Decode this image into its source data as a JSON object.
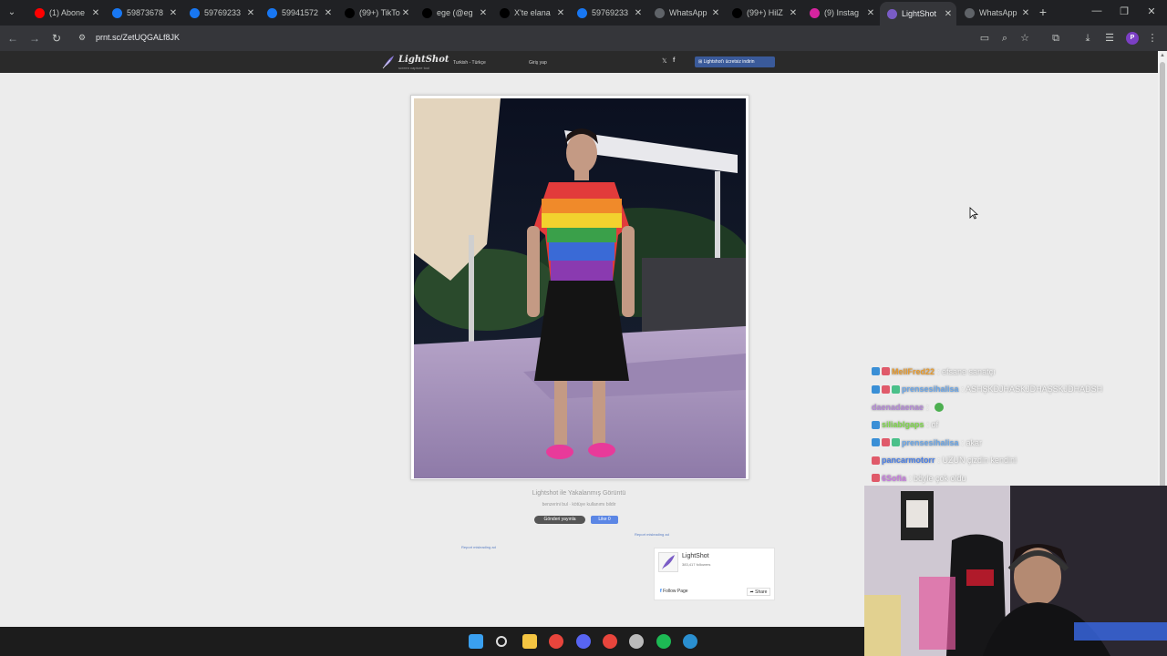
{
  "browser": {
    "tabs": [
      {
        "title": "(1) Abone",
        "favicon": "youtube-icon",
        "color": "#ff0000"
      },
      {
        "title": "59873678",
        "favicon": "facebook-icon",
        "color": "#1877f2"
      },
      {
        "title": "59769233",
        "favicon": "facebook-icon",
        "color": "#1877f2"
      },
      {
        "title": "59941572",
        "favicon": "facebook-icon",
        "color": "#1877f2"
      },
      {
        "title": "(99+) TikTo",
        "favicon": "tiktok-icon",
        "color": "#000000"
      },
      {
        "title": "ege (@eg",
        "favicon": "x-icon",
        "color": "#000000"
      },
      {
        "title": "X'te elana",
        "favicon": "x-icon",
        "color": "#000000"
      },
      {
        "title": "59769233",
        "favicon": "facebook-icon",
        "color": "#1877f2"
      },
      {
        "title": "WhatsApp",
        "favicon": "globe-icon",
        "color": "#5f6368"
      },
      {
        "title": "(99+) HilZ",
        "favicon": "tiktok-icon",
        "color": "#000000"
      },
      {
        "title": "(9) Instag",
        "favicon": "instagram-icon",
        "color": "#d6249f"
      },
      {
        "title": "LightShot",
        "favicon": "lightshot-icon",
        "color": "#7a5cc6",
        "active": true
      },
      {
        "title": "WhatsApp",
        "favicon": "globe-icon",
        "color": "#5f6368"
      }
    ],
    "url": "prnt.sc/ZetUQGALf8JK",
    "profile_initial": "P"
  },
  "lightshot": {
    "brand": "LightShot",
    "tagline": "screen capture tool",
    "language": "Turkish - Türkçe",
    "login": "Giriş yap",
    "install_button": "Lightshot'ı ücretsiz indirin",
    "caption": "Lightshot ile Yakalanmış Görüntü",
    "caption_links": "benzerini bul · kötüye kullanımı bildir",
    "share_x": "Gönderi yayınla",
    "share_fb": "Like 0",
    "report_ad_1": "Report misleading ad",
    "report_ad_2": "Report misleading ad",
    "fb_widget": {
      "name": "LightShot",
      "followers": "383,417 followers",
      "follow": "Follow Page",
      "share": "Share"
    }
  },
  "chat": [
    {
      "user": "MellFred22",
      "color": "#e89a2b",
      "message": ": efsane sanatçı",
      "badges": [
        "#3a8fd6",
        "#e05a6a"
      ]
    },
    {
      "user": "prensesihalisa",
      "color": "#6aa6e8",
      "message": ": ASHŞKDJHASKJDHAŞSKJDHADSH",
      "badges": [
        "#3a8fd6",
        "#e05a6a",
        "#4ac08a"
      ]
    },
    {
      "user": "daenadaenae",
      "color": "#b388d6",
      "message": ":",
      "badges": [],
      "emote": true
    },
    {
      "user": "siliablgaps",
      "color": "#7fd94a",
      "message": ": of",
      "badges": [
        "#3a8fd6"
      ]
    },
    {
      "user": "prensesihalisa",
      "color": "#6aa6e8",
      "message": ": akar",
      "badges": [
        "#3a8fd6",
        "#e05a6a",
        "#4ac08a"
      ]
    },
    {
      "user": "pancarmotorr",
      "color": "#4a7fe8",
      "message": ": UZUN çizdin kendini",
      "badges": [
        "#e05a6a"
      ]
    },
    {
      "user": "6Sofia",
      "color": "#c77ae0",
      "message": ": böyle çok oldu",
      "badges": [
        "#e05a6a"
      ]
    }
  ],
  "taskbar": {
    "apps": [
      {
        "name": "windows-start-icon",
        "color": "#3aa0f0"
      },
      {
        "name": "search-icon",
        "color": "#dddddd"
      },
      {
        "name": "file-explorer-icon",
        "color": "#f4c542"
      },
      {
        "name": "chrome-icon",
        "color": "#e8453c"
      },
      {
        "name": "discord-icon",
        "color": "#5865f2"
      },
      {
        "name": "chrome-icon",
        "color": "#e8453c"
      },
      {
        "name": "obs-icon",
        "color": "#bbbbbb"
      },
      {
        "name": "spotify-icon",
        "color": "#1db954"
      },
      {
        "name": "globe-icon",
        "color": "#2a8fd0"
      }
    ]
  }
}
